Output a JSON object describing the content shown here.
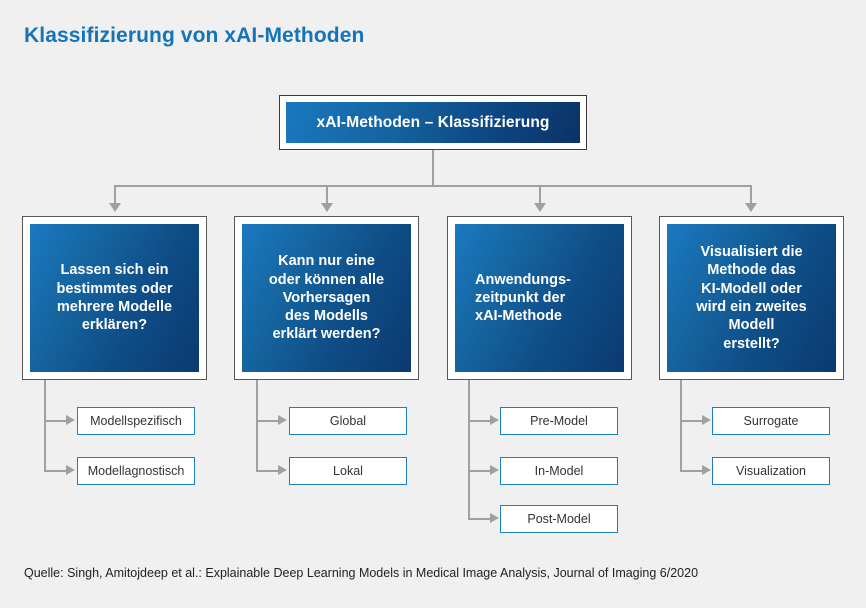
{
  "page": {
    "title": "Klassifizierung von xAI-Methoden",
    "background_color": "#f0f0f0",
    "title_color": "#1574b8",
    "source": "Quelle: Singh, Amitojdeep et al.: Explainable Deep Learning Models in Medical Image Analysis, Journal of Imaging 6/2020"
  },
  "diagram": {
    "root": {
      "label": "xAI-Methoden – Klassifizierung",
      "fill_start": "#1a78bf",
      "fill_end": "#0a3366",
      "border_color": "#3b3b3b",
      "text_color": "#ffffff"
    },
    "categories": [
      {
        "label": "Lassen sich ein\nbestimmtes oder\nmehrere Modelle\nerklären?",
        "align": "center",
        "leaves": [
          {
            "label": "Modellspezifisch"
          },
          {
            "label": "Modellagnostisch"
          }
        ]
      },
      {
        "label": "Kann nur eine\noder können alle\nVorhersagen\ndes Modells\nerklärt werden?",
        "align": "center",
        "leaves": [
          {
            "label": "Global"
          },
          {
            "label": "Lokal"
          }
        ]
      },
      {
        "label": "Anwendungs-\nzeitpunkt der\nxAI-Methode",
        "align": "left",
        "leaves": [
          {
            "label": "Pre-Model"
          },
          {
            "label": "In-Model"
          },
          {
            "label": "Post-Model"
          }
        ]
      },
      {
        "label": "Visualisiert die\nMethode das\nKI-Modell oder\nwird ein zweites\nModell\nerstellt?",
        "align": "center",
        "leaves": [
          {
            "label": "Surrogate"
          },
          {
            "label": "Visualization"
          }
        ]
      }
    ],
    "leaf_style": {
      "border_color": "#1a7ec0",
      "fill_color": "#ffffff",
      "text_color": "#333333"
    },
    "connector_color": "#a0a0a0"
  }
}
